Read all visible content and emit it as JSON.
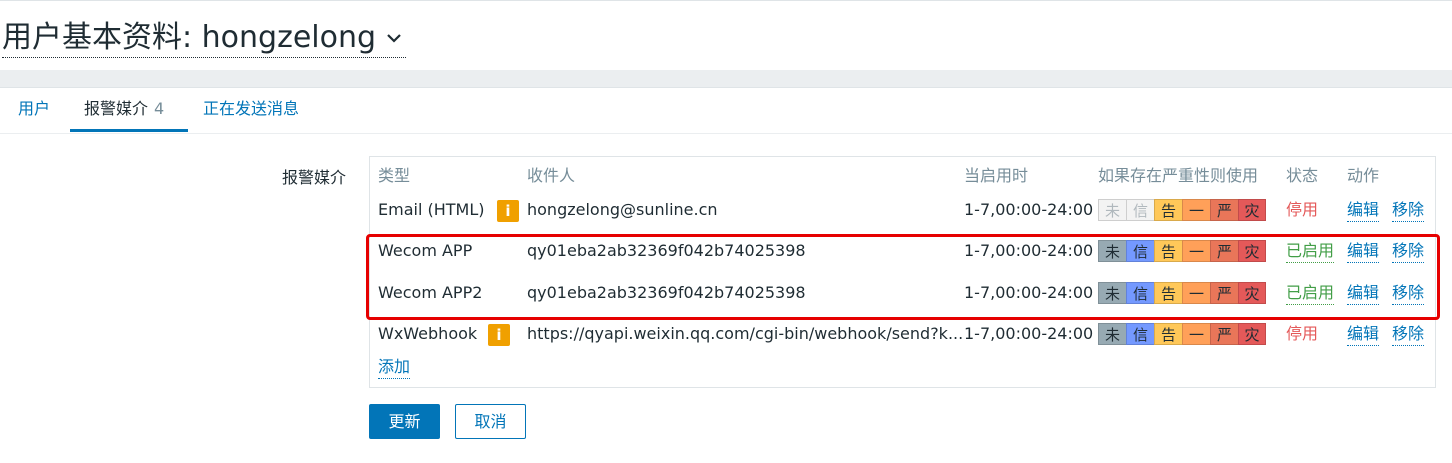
{
  "page": {
    "title": "用户基本资料: hongzelong"
  },
  "tabs": [
    {
      "label": "用户",
      "count": ""
    },
    {
      "label": "报警媒介",
      "count": "4"
    },
    {
      "label": "正在发送消息",
      "count": ""
    }
  ],
  "form": {
    "media_label": "报警媒介"
  },
  "table": {
    "headers": {
      "type": "类型",
      "recipient": "收件人",
      "when": "当启用时",
      "severity": "如果存在严重性则使用",
      "status": "状态",
      "action": "动作"
    },
    "severity_labels": [
      "未",
      "信",
      "告",
      "一",
      "严",
      "灾"
    ],
    "severity_colors": [
      "#97aab3",
      "#7499ff",
      "#ffc859",
      "#ffa059",
      "#e97659",
      "#e45959"
    ],
    "rows": [
      {
        "type": "Email (HTML)",
        "has_info": true,
        "recipient": "hongzelong@sunline.cn",
        "when": "1-7,00:00-24:00",
        "severity_enabled": [
          false,
          false,
          true,
          true,
          true,
          true
        ],
        "status": "停用",
        "status_enabled": false,
        "edit": "编辑",
        "remove": "移除"
      },
      {
        "type": "Wecom APP",
        "has_info": false,
        "recipient": "qy01eba2ab32369f042b74025398",
        "when": "1-7,00:00-24:00",
        "severity_enabled": [
          true,
          true,
          true,
          true,
          true,
          true
        ],
        "status": "已启用",
        "status_enabled": true,
        "edit": "编辑",
        "remove": "移除"
      },
      {
        "type": "Wecom APP2",
        "has_info": false,
        "recipient": "qy01eba2ab32369f042b74025398",
        "when": "1-7,00:00-24:00",
        "severity_enabled": [
          true,
          true,
          true,
          true,
          true,
          true
        ],
        "status": "已启用",
        "status_enabled": true,
        "edit": "编辑",
        "remove": "移除"
      },
      {
        "type": "WxWebhook",
        "has_info": true,
        "recipient": "https://qyapi.weixin.qq.com/cgi-bin/webhook/send?k...",
        "when": "1-7,00:00-24:00",
        "severity_enabled": [
          true,
          true,
          true,
          true,
          true,
          true
        ],
        "status": "停用",
        "status_enabled": false,
        "edit": "编辑",
        "remove": "移除"
      }
    ],
    "add_link": "添加"
  },
  "buttons": {
    "update": "更新",
    "cancel": "取消"
  },
  "icons": {
    "info": "info-icon",
    "chevron": "chevron-down-icon"
  }
}
